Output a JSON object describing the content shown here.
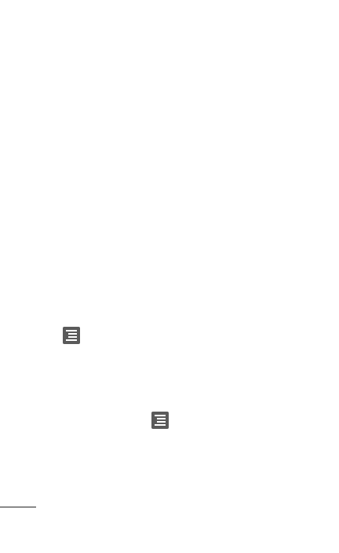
{
  "page": {
    "background": "#ffffff"
  },
  "icons": [
    {
      "name": "menu-icon",
      "color": "#5a5a5a"
    },
    {
      "name": "menu-icon",
      "color": "#5a5a5a"
    }
  ],
  "footnote_rule": {
    "color": "#222222"
  }
}
